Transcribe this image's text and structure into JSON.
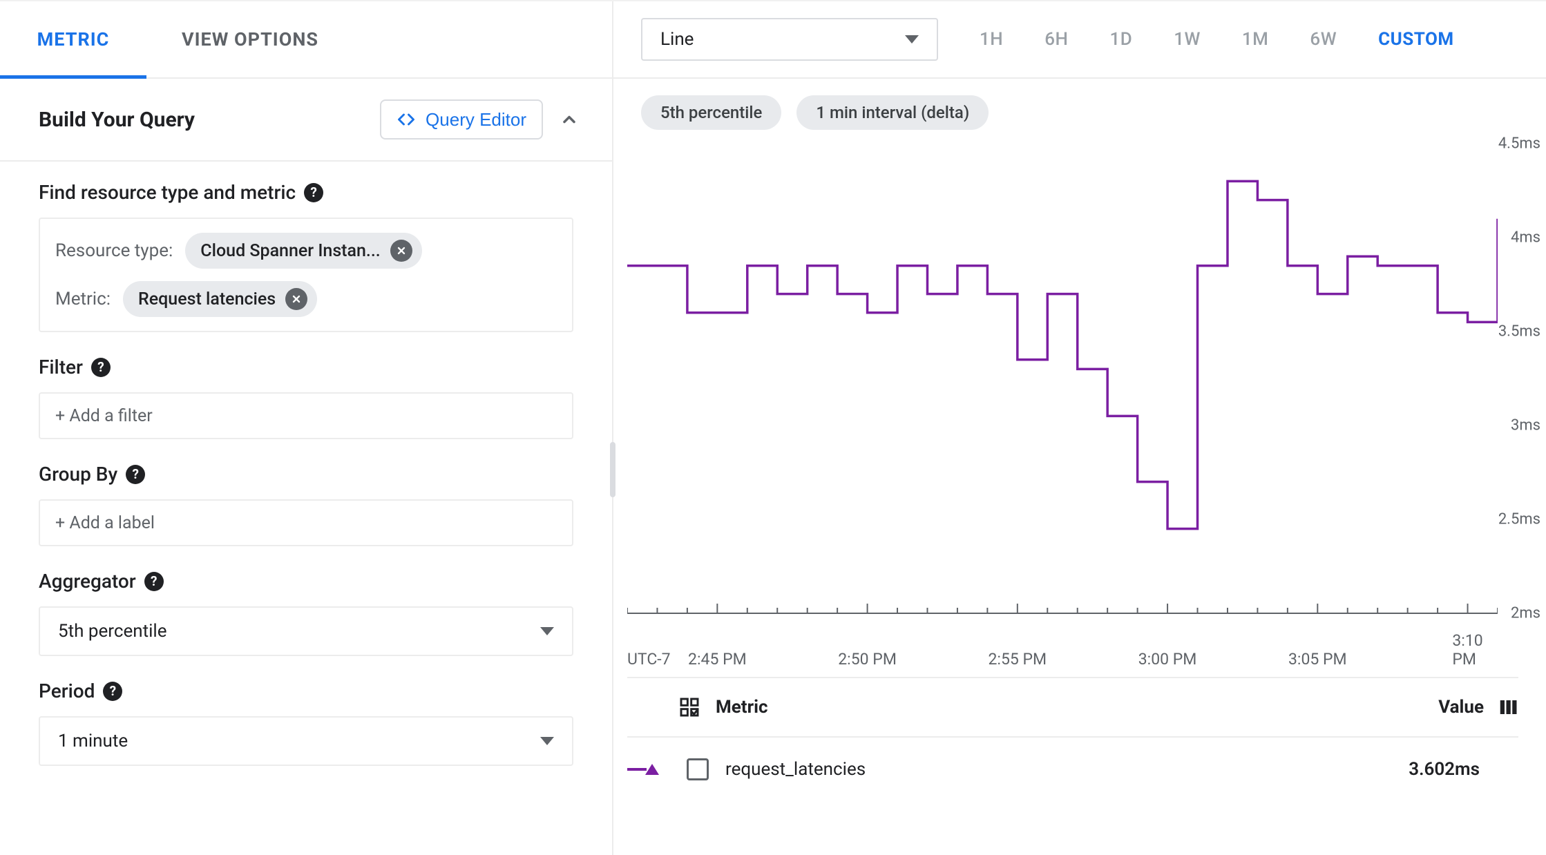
{
  "tabs": {
    "metric": "METRIC",
    "view_options": "VIEW OPTIONS"
  },
  "query": {
    "header": "Build Your Query",
    "editor_button": "Query Editor",
    "find_label": "Find resource type and metric",
    "resource_type_label": "Resource type:",
    "resource_type_value": "Cloud Spanner Instan...",
    "metric_label": "Metric:",
    "metric_value": "Request latencies",
    "filter": {
      "label": "Filter",
      "placeholder": "+ Add a filter"
    },
    "group_by": {
      "label": "Group By",
      "placeholder": "+ Add a label"
    },
    "aggregator": {
      "label": "Aggregator",
      "value": "5th percentile"
    },
    "period": {
      "label": "Period",
      "value": "1 minute"
    }
  },
  "toolbar": {
    "chart_type": "Line",
    "ranges": [
      "1H",
      "6H",
      "1D",
      "1W",
      "1M",
      "6W",
      "CUSTOM"
    ],
    "active_range": "CUSTOM"
  },
  "chart": {
    "badges": [
      "5th percentile",
      "1 min interval (delta)"
    ],
    "y_ticks": [
      "4.5ms",
      "4ms",
      "3.5ms",
      "3ms",
      "2.5ms",
      "2ms"
    ],
    "x_ticks": [
      "2:45 PM",
      "2:50 PM",
      "2:55 PM",
      "3:00 PM",
      "3:05 PM",
      "3:10 PM"
    ],
    "timezone": "UTC-7",
    "series_color": "#7b1fa2"
  },
  "chart_data": {
    "type": "line",
    "title": "",
    "xlabel": "",
    "ylabel": "",
    "ylim": [
      2,
      4.5
    ],
    "x_minutes": [
      42,
      43,
      44,
      45,
      46,
      47,
      48,
      49,
      50,
      51,
      52,
      53,
      54,
      55,
      56,
      57,
      58,
      59,
      60,
      61,
      62,
      63,
      64,
      65,
      66,
      67,
      68,
      69,
      70,
      71
    ],
    "series": [
      {
        "name": "request_latencies",
        "values": [
          3.85,
          3.85,
          3.6,
          3.6,
          3.85,
          3.7,
          3.85,
          3.7,
          3.6,
          3.85,
          3.7,
          3.85,
          3.7,
          3.35,
          3.7,
          3.3,
          3.05,
          2.7,
          2.45,
          3.85,
          4.3,
          4.2,
          3.85,
          3.7,
          3.9,
          3.85,
          3.85,
          3.6,
          3.55,
          4.1
        ]
      }
    ]
  },
  "legend": {
    "header_metric": "Metric",
    "header_value": "Value",
    "row": {
      "name": "request_latencies",
      "value": "3.602ms"
    }
  }
}
